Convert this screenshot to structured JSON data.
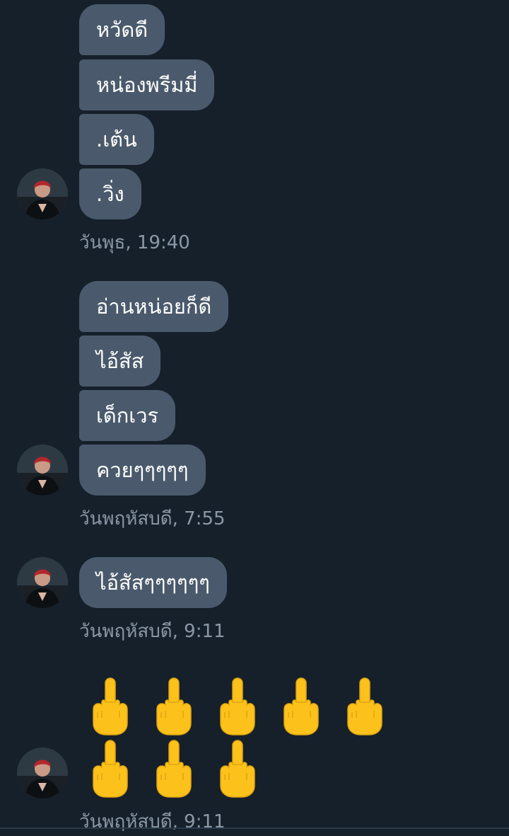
{
  "colors": {
    "background": "#16202b",
    "bubble": "#4a5a6c",
    "bubble_text": "#ffffff",
    "timestamp": "#8b98a5",
    "emoji": "#fcc21b"
  },
  "avatar": {
    "icon": "user-avatar"
  },
  "groups": [
    {
      "messages": [
        "หวัดดี",
        "หน่องพรีมมี่",
        ".เต้น",
        ".วิ่ง"
      ],
      "timestamp": "วันพุธ, 19:40"
    },
    {
      "messages": [
        "อ่านหน่อยก็ดี",
        "ไอ้สัส",
        "เด็กเวร",
        "ควยๆๆๆๆๆ"
      ],
      "timestamp": "วันพฤหัสบดี, 7:55"
    },
    {
      "messages": [
        "ไอ้สัสๆๆๆๆๆๆ"
      ],
      "timestamp": "วันพฤหัสบดี, 9:11"
    },
    {
      "emoji": {
        "name": "middle-finger-icon",
        "count_row1": 5,
        "count_row2": 3
      },
      "timestamp": "วันพฤหัสบดี, 9:11"
    }
  ]
}
